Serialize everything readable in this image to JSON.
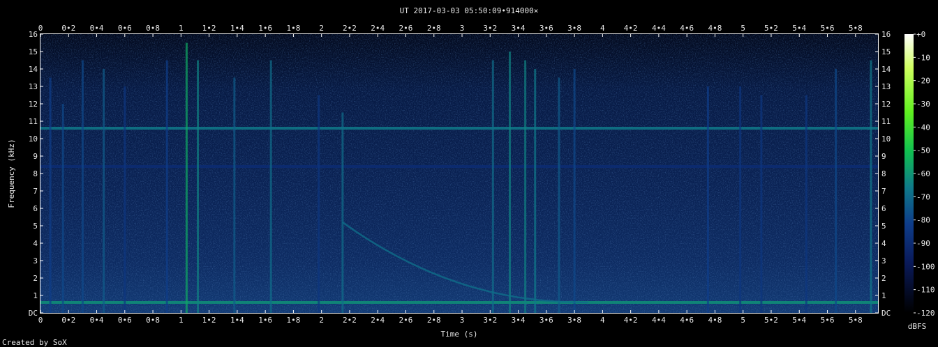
{
  "chart_data": {
    "type": "heatmap",
    "title": "UT 2017-03-03 05:50:09•914000×",
    "xlabel": "Time (s)",
    "ylabel": "Frequency (kHz)",
    "xlim": [
      0,
      5.96
    ],
    "ylim_khz": [
      0,
      16
    ],
    "x_ticks": [
      "0",
      "0•2",
      "0•4",
      "0•6",
      "0•8",
      "1",
      "1•2",
      "1•4",
      "1•6",
      "1•8",
      "2",
      "2•2",
      "2•4",
      "2•6",
      "2•8",
      "3",
      "3•2",
      "3•4",
      "3•6",
      "3•8",
      "4",
      "4•2",
      "4•4",
      "4•6",
      "4•8",
      "5",
      "5•2",
      "5•4",
      "5•6",
      "5•8"
    ],
    "y_ticks": [
      "DC",
      "1",
      "2",
      "3",
      "4",
      "5",
      "6",
      "7",
      "8",
      "9",
      "10",
      "11",
      "12",
      "13",
      "14",
      "15",
      "16"
    ],
    "colorbar": {
      "label": "dBFS",
      "ticks": [
        "+0",
        "-10",
        "-20",
        "-30",
        "-40",
        "-50",
        "-60",
        "-70",
        "-80",
        "-90",
        "-100",
        "-110",
        "-120"
      ],
      "range": [
        -120,
        0
      ],
      "colors": [
        "#000000",
        "#0a1a5a",
        "#0e3d8a",
        "#0f7a8a",
        "#10c050",
        "#60f020",
        "#d0ff60",
        "#ffffff"
      ]
    },
    "background_level_dbfs": -100,
    "features": {
      "horizontal_lines_khz": [
        {
          "freq": 10.6,
          "level_dbfs": -80
        },
        {
          "freq": 0.6,
          "level_dbfs": -75
        },
        {
          "freq": 8.4,
          "level_dbfs": -95
        }
      ],
      "vertical_bursts": [
        {
          "t": 0.07,
          "f_top": 13.5,
          "level_dbfs": -90
        },
        {
          "t": 0.16,
          "f_top": 12.0,
          "level_dbfs": -88
        },
        {
          "t": 0.3,
          "f_top": 14.5,
          "level_dbfs": -88
        },
        {
          "t": 0.45,
          "f_top": 14.0,
          "level_dbfs": -85
        },
        {
          "t": 0.6,
          "f_top": 13.0,
          "level_dbfs": -92
        },
        {
          "t": 0.9,
          "f_top": 14.5,
          "level_dbfs": -90
        },
        {
          "t": 1.04,
          "f_top": 15.5,
          "level_dbfs": -70
        },
        {
          "t": 1.12,
          "f_top": 14.5,
          "level_dbfs": -78
        },
        {
          "t": 1.38,
          "f_top": 13.5,
          "level_dbfs": -85
        },
        {
          "t": 1.64,
          "f_top": 14.5,
          "level_dbfs": -82
        },
        {
          "t": 1.98,
          "f_top": 12.5,
          "level_dbfs": -92
        },
        {
          "t": 2.15,
          "f_top": 11.5,
          "level_dbfs": -82
        },
        {
          "t": 3.22,
          "f_top": 14.5,
          "level_dbfs": -82
        },
        {
          "t": 3.34,
          "f_top": 15.0,
          "level_dbfs": -78
        },
        {
          "t": 3.45,
          "f_top": 14.5,
          "level_dbfs": -78
        },
        {
          "t": 3.52,
          "f_top": 14.0,
          "level_dbfs": -80
        },
        {
          "t": 3.69,
          "f_top": 13.5,
          "level_dbfs": -85
        },
        {
          "t": 3.8,
          "f_top": 14.0,
          "level_dbfs": -88
        },
        {
          "t": 4.75,
          "f_top": 13.0,
          "level_dbfs": -90
        },
        {
          "t": 4.98,
          "f_top": 13.0,
          "level_dbfs": -92
        },
        {
          "t": 5.13,
          "f_top": 12.5,
          "level_dbfs": -92
        },
        {
          "t": 5.45,
          "f_top": 12.5,
          "level_dbfs": -92
        },
        {
          "t": 5.66,
          "f_top": 14.0,
          "level_dbfs": -88
        },
        {
          "t": 5.91,
          "f_top": 14.5,
          "level_dbfs": -80
        }
      ],
      "whistler": {
        "t_start": 2.15,
        "f_start_khz": 5.2,
        "t_end": 3.9,
        "f_end_khz": 0.6,
        "level_dbfs": -82
      }
    }
  },
  "footer": "Created by SoX"
}
